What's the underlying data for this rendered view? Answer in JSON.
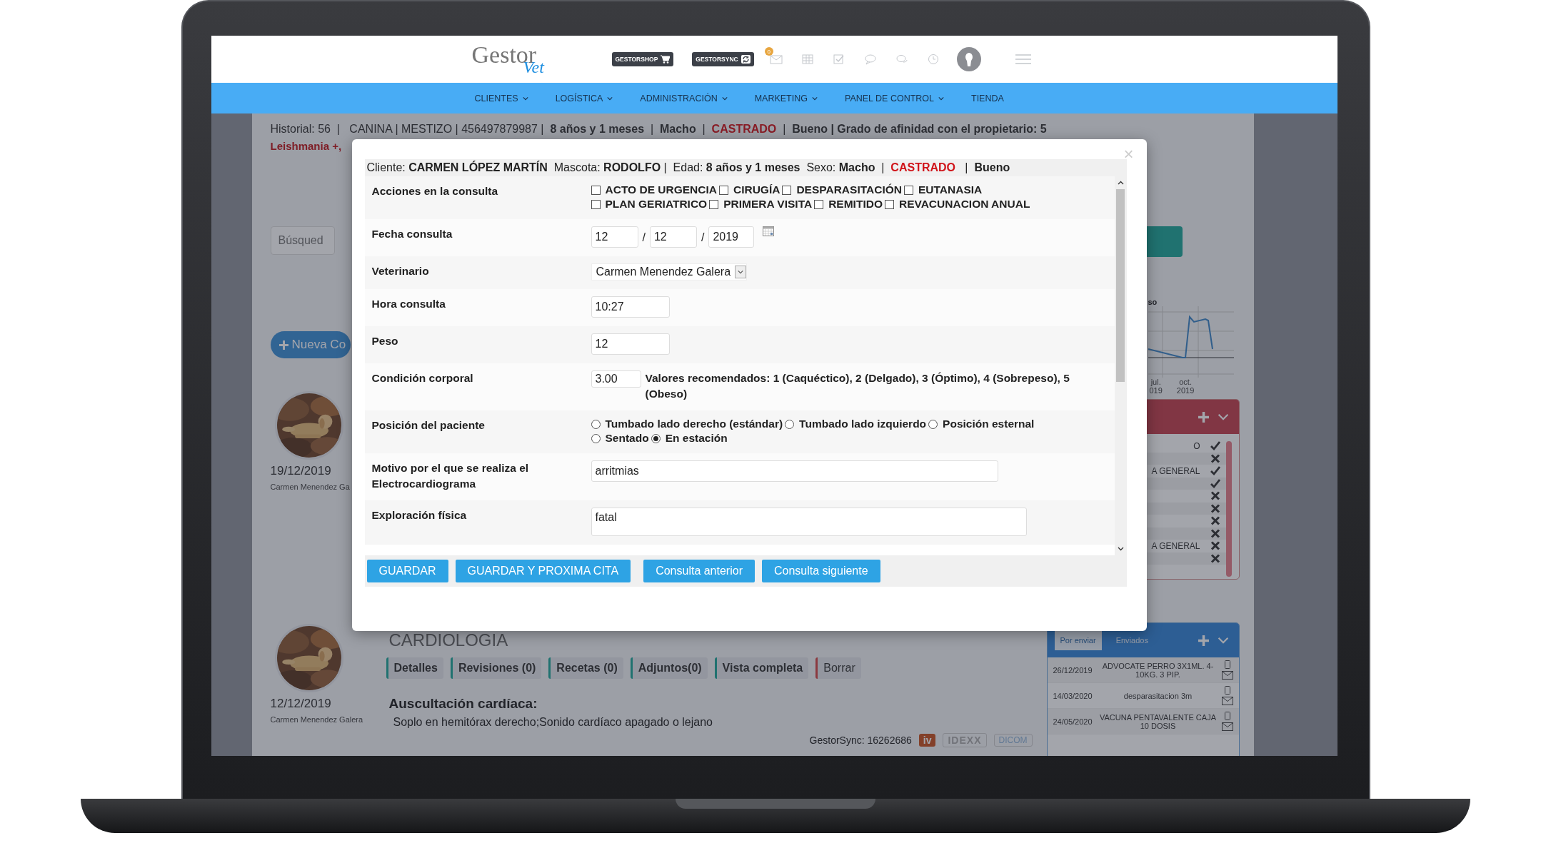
{
  "header": {
    "logo_main": "Gestor",
    "logo_sub": "Vet",
    "shop_button": "GESTORSHOP",
    "sync_button": "GESTORSYNC",
    "notification_count": "0"
  },
  "nav": [
    {
      "label": "CLIENTES",
      "dropdown": true
    },
    {
      "label": "LOGÍSTICA",
      "dropdown": true
    },
    {
      "label": "ADMINISTRACIÓN",
      "dropdown": true
    },
    {
      "label": "MARKETING",
      "dropdown": true
    },
    {
      "label": "PANEL DE CONTROL",
      "dropdown": true
    },
    {
      "label": "TIENDA",
      "dropdown": false
    }
  ],
  "patient_bar": {
    "before": "Historial: 56  |   CANINA | MESTIZO | 456497879987 |  **8 años y 1 meses**  |  **Macho**  |  ",
    "status": "CASTRADO",
    "after": "  |  **Bueno | Grado de afinidad con el propietario: 5**"
  },
  "alerts": "Leishmania +,",
  "search": {
    "placeholder": "Búsqued"
  },
  "new_button": "Nueva Co",
  "timeline": [
    {
      "date": "19/12/2019",
      "vet": "Carmen Menendez Ga"
    },
    {
      "date": "12/12/2019",
      "vet": "Carmen Menendez Galera"
    }
  ],
  "consultation": {
    "title": "CARDIOLOGIA",
    "actions": [
      {
        "label": "Detalles",
        "kind": "normal"
      },
      {
        "label": "Revisiones (0)",
        "kind": "normal"
      },
      {
        "label": "Recetas (0)",
        "kind": "normal"
      },
      {
        "label": "Adjuntos(0)",
        "kind": "normal"
      },
      {
        "label": "Vista completa",
        "kind": "normal"
      },
      {
        "label": "Borrar",
        "kind": "danger"
      }
    ],
    "section_title": "Auscultación cardíaca:",
    "section_text": "Soplo en hemitórax derecho;Sonido cardíaco apagado o lejano",
    "sync_id": "GestorSync: 16262686",
    "integrations": [
      {
        "label": "iv",
        "kind": "iv"
      },
      {
        "label": "IDEXX",
        "kind": "idexx"
      },
      {
        "label": "DICOM",
        "kind": "dicom"
      }
    ]
  },
  "weight_chart": {
    "title": "so",
    "x_labels": [
      {
        "month": "jul.",
        "year": "019"
      },
      {
        "month": "oct.",
        "year": "2019"
      }
    ]
  },
  "tasks_panel": {
    "items": [
      {
        "text": "O",
        "done": true
      },
      {
        "done": false
      },
      {
        "text": "A GENERAL",
        "done": true
      },
      {
        "done": true
      },
      {
        "done": false
      },
      {
        "done": false
      },
      {
        "done": false
      },
      {
        "done": false
      },
      {
        "text": "A GENERAL",
        "done": false
      },
      {
        "done": false
      }
    ]
  },
  "reminders_panel": {
    "tabs": [
      {
        "label": "Por enviar",
        "selected": true
      },
      {
        "label": "Enviados",
        "selected": false
      }
    ],
    "items": [
      {
        "date": "26/12/2019",
        "text": "ADVOCATE PERRO 3X1ML. 4-10KG. 3 PIP."
      },
      {
        "date": "14/03/2020",
        "text": "desparasitacion 3m"
      },
      {
        "date": "24/05/2020",
        "text": "VACUNA PENTAVALENTE CAJA 10 DOSIS"
      }
    ]
  },
  "modal": {
    "close_label": "×",
    "summary": {
      "before": "Cliente: **CARMEN LÓPEZ MARTÍN**  Mascota: **RODOLFO** |  Edad: **8 años y 1 meses**  Sexo: **Macho**  |  ",
      "status": "CASTRADO",
      "after": "   |  **Bueno**"
    },
    "rows": [
      {
        "kind": "checks",
        "label": "Acciones en la consulta",
        "options": [
          {
            "label": "ACTO DE URGENCIA",
            "checked": false
          },
          {
            "label": "CIRUGÍA",
            "checked": false
          },
          {
            "label": "DESPARASITACIÓN",
            "checked": false
          },
          {
            "label": "EUTANASIA",
            "checked": false
          },
          {
            "label": "PLAN GERIATRICO",
            "checked": false
          },
          {
            "label": "PRIMERA VISITA",
            "checked": false
          },
          {
            "label": "REMITIDO",
            "checked": false
          },
          {
            "label": "REVACUNACION ANUAL",
            "checked": false
          }
        ]
      },
      {
        "kind": "date",
        "label": "Fecha consulta",
        "day": "12",
        "separator": "/",
        "month": "12",
        "year": "2019"
      },
      {
        "kind": "select",
        "label": "Veterinario",
        "value": "Carmen Menendez Galera"
      },
      {
        "kind": "input",
        "label": "Hora consulta",
        "value": "10:27"
      },
      {
        "kind": "input",
        "label": "Peso",
        "value": "12"
      },
      {
        "kind": "input_note",
        "label": "Condición corporal",
        "value": "3.00",
        "note": "Valores recomendados: 1 (Caquéctico), 2 (Delgado), 3 (Óptimo), 4 (Sobrepeso), 5 (Obeso)"
      },
      {
        "kind": "radios",
        "label": "Posición del paciente",
        "options": [
          {
            "label": "Tumbado lado derecho (estándar)",
            "selected": false
          },
          {
            "label": "Tumbado lado izquierdo",
            "selected": false
          },
          {
            "label": "Posición esternal",
            "selected": false
          },
          {
            "label": "Sentado",
            "selected": false
          },
          {
            "label": "En estación",
            "selected": true
          }
        ]
      },
      {
        "kind": "long_input",
        "label": "Motivo por el que se realiza el Electrocardiograma",
        "value": "arritmias"
      },
      {
        "kind": "textarea",
        "label": "Exploración física",
        "value": "fatal"
      }
    ],
    "buttons": [
      "GUARDAR",
      "GUARDAR Y PROXIMA CITA",
      "Consulta anterior",
      "Consulta siguiente"
    ]
  }
}
